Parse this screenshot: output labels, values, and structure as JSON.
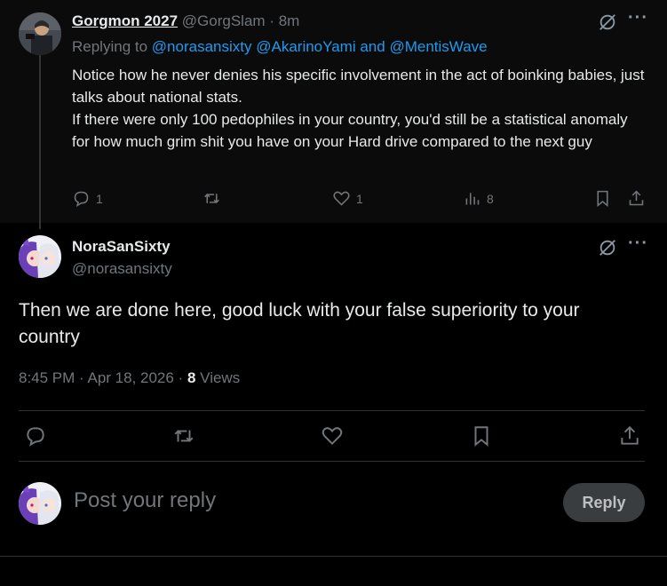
{
  "parent_tweet": {
    "author_name": "Gorgmon 2027",
    "handle": "@GorgSlam",
    "time": "· 8m",
    "replying_prefix": "Replying to",
    "replying_to": [
      "@norasansixty",
      "@AkarinoYami"
    ],
    "replying_and": "and",
    "replying_last": "@MentisWave",
    "body_line1": "Notice how he never denies his specific involvement in the act of boinking babies, just talks about national stats.",
    "body_line2": "If there were only 100 pedophiles in your country, you'd still be a statistical anomaly for how much grim shit you have on your Hard drive compared to the next guy",
    "reply_count": "1",
    "like_count": "1",
    "view_count": "8"
  },
  "main_tweet": {
    "author_name": "NoraSanSixty",
    "handle": "@norasansixty",
    "body": "Then we are done here, good luck with your false superiority to your country",
    "timestamp": "8:45 PM · Apr 18, 2026 ·",
    "views_count": "8",
    "views_label": "Views"
  },
  "reply_box": {
    "placeholder": "Post your reply",
    "button_label": "Reply"
  },
  "icons": [
    "grok-icon",
    "more-icon",
    "reply-icon",
    "retweet-icon",
    "like-icon",
    "views-icon",
    "bookmark-icon",
    "share-icon"
  ],
  "colors": {
    "background": "#000000",
    "text": "#e7e9ea",
    "muted": "#71767b",
    "link": "#1d9bf0"
  }
}
